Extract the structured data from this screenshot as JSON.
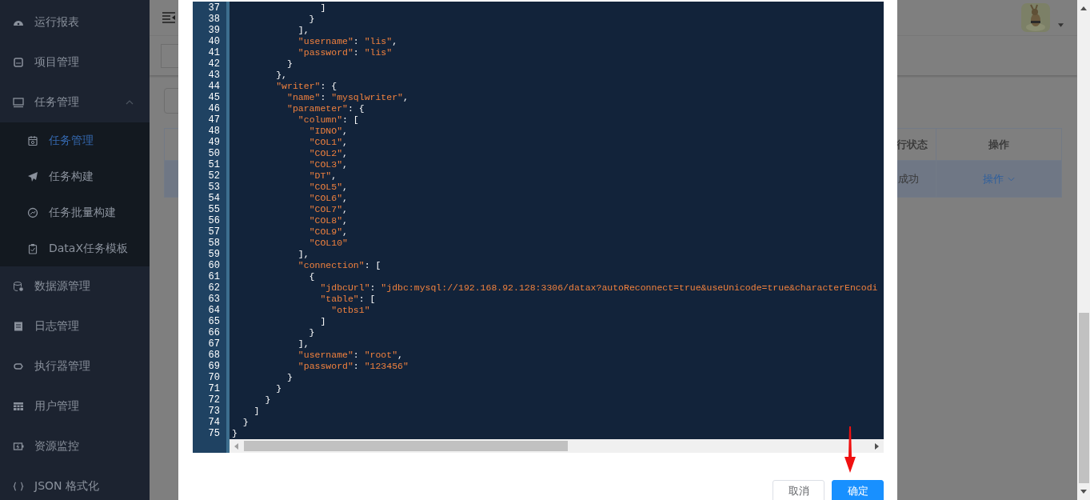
{
  "sidebar": {
    "items": [
      {
        "label": "运行报表",
        "selected": false
      },
      {
        "label": "项目管理",
        "selected": false
      },
      {
        "label": "任务管理",
        "selected": false,
        "expanded": true,
        "children": [
          {
            "label": "任务管理",
            "selected": true
          },
          {
            "label": "任务构建",
            "selected": false
          },
          {
            "label": "任务批量构建",
            "selected": false
          },
          {
            "label": "DataX任务模板",
            "selected": false
          }
        ]
      },
      {
        "label": "数据源管理",
        "selected": false
      },
      {
        "label": "日志管理",
        "selected": false
      },
      {
        "label": "执行器管理",
        "selected": false
      },
      {
        "label": "用户管理",
        "selected": false
      },
      {
        "label": "资源监控",
        "selected": false
      },
      {
        "label": "JSON 格式化",
        "selected": false
      }
    ]
  },
  "table": {
    "columns": [
      "行状态",
      "操作"
    ],
    "rows": [
      {
        "selected": true,
        "cells": [
          "成功",
          "操作"
        ]
      }
    ]
  },
  "dialog": {
    "editor": {
      "lines": [
        {
          "number": "37",
          "text": "                ]"
        },
        {
          "number": "38",
          "text": "              }"
        },
        {
          "number": "39",
          "text": "            ],"
        },
        {
          "number": "40",
          "text": "            \"username\": \"lis\","
        },
        {
          "number": "41",
          "text": "            \"password\": \"lis\""
        },
        {
          "number": "42",
          "text": "          }"
        },
        {
          "number": "43",
          "text": "        },"
        },
        {
          "number": "44",
          "text": "        \"writer\": {"
        },
        {
          "number": "45",
          "text": "          \"name\": \"mysqlwriter\","
        },
        {
          "number": "46",
          "text": "          \"parameter\": {"
        },
        {
          "number": "47",
          "text": "            \"column\": ["
        },
        {
          "number": "48",
          "text": "              \"IDNO\","
        },
        {
          "number": "49",
          "text": "              \"COL1\","
        },
        {
          "number": "50",
          "text": "              \"COL2\","
        },
        {
          "number": "51",
          "text": "              \"COL3\","
        },
        {
          "number": "52",
          "text": "              \"DT\","
        },
        {
          "number": "53",
          "text": "              \"COL5\","
        },
        {
          "number": "54",
          "text": "              \"COL6\","
        },
        {
          "number": "55",
          "text": "              \"COL7\","
        },
        {
          "number": "56",
          "text": "              \"COL8\","
        },
        {
          "number": "57",
          "text": "              \"COL9\","
        },
        {
          "number": "58",
          "text": "              \"COL10\""
        },
        {
          "number": "59",
          "text": "            ],"
        },
        {
          "number": "60",
          "text": "            \"connection\": ["
        },
        {
          "number": "61",
          "text": "              {"
        },
        {
          "number": "62",
          "text": "                \"jdbcUrl\": \"jdbc:mysql://192.168.92.128:3306/datax?autoReconnect=true&useUnicode=true&characterEncodi"
        },
        {
          "number": "63",
          "text": "                \"table\": ["
        },
        {
          "number": "64",
          "text": "                  \"otbs1\""
        },
        {
          "number": "65",
          "text": "                ]"
        },
        {
          "number": "66",
          "text": "              }"
        },
        {
          "number": "67",
          "text": "            ],"
        },
        {
          "number": "68",
          "text": "            \"username\": \"root\","
        },
        {
          "number": "69",
          "text": "            \"password\": \"123456\""
        },
        {
          "number": "70",
          "text": "          }"
        },
        {
          "number": "71",
          "text": "        }"
        },
        {
          "number": "72",
          "text": "      }"
        },
        {
          "number": "73",
          "text": "    ]"
        },
        {
          "number": "74",
          "text": "  }"
        },
        {
          "number": "75",
          "text": "}"
        }
      ]
    },
    "buttons": [
      {
        "label": "取消",
        "kind": "secondary"
      },
      {
        "label": "确定",
        "kind": "primary"
      }
    ]
  }
}
